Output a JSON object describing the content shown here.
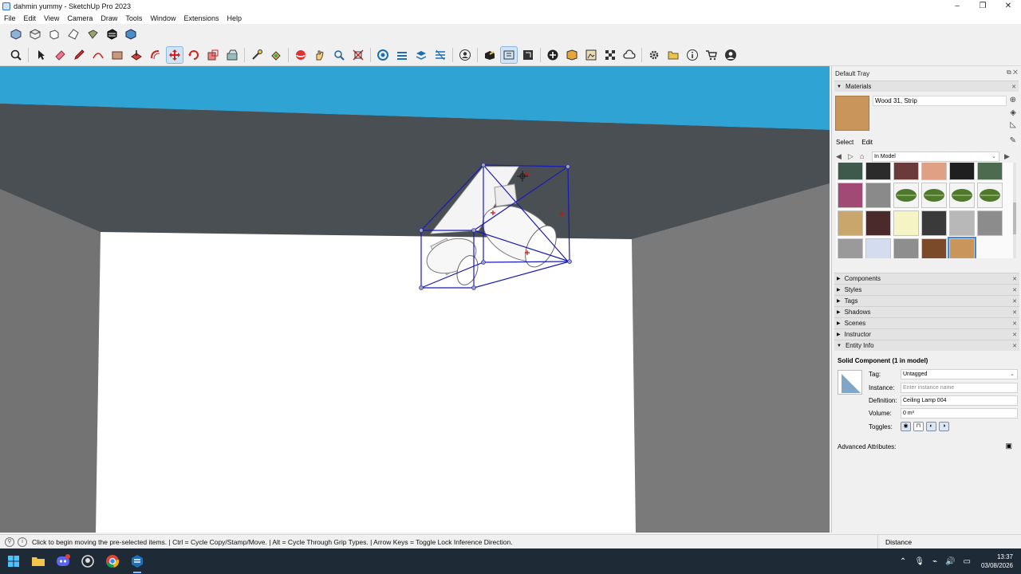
{
  "window": {
    "title": "dahmin yummy - SketchUp Pro 2023",
    "minimize": "–",
    "maximize": "❐",
    "close": "✕"
  },
  "menu": [
    "File",
    "Edit",
    "View",
    "Camera",
    "Draw",
    "Tools",
    "Window",
    "Extensions",
    "Help"
  ],
  "toolbar_top": [
    "iso-view-icon",
    "top-view-icon",
    "front-view-icon",
    "right-view-icon",
    "back-view-icon",
    "left-view-icon",
    "bottom-view-icon"
  ],
  "toolbar_main": [
    "zoom-icon",
    "select-icon",
    "eraser-icon",
    "pencil-icon",
    "arc-icon",
    "rectangle-icon",
    "pushpull-icon",
    "offset-icon",
    "move-icon",
    "rotate-icon",
    "scale-icon",
    "followme-icon",
    "tape-icon",
    "paint-icon",
    "orbit-icon",
    "pan-icon",
    "zoom-window-icon",
    "zoom-extents-icon",
    "section-plane-icon",
    "display-section-icon",
    "section-fill-icon",
    "section-cuts-icon",
    "user-icon",
    "3d-warehouse-icon",
    "extension-warehouse-icon",
    "layout-icon",
    "add-location-icon",
    "geo-icon",
    "photo-texture-icon",
    "scan-icon",
    "cloud-icon",
    "settings-icon",
    "folder-icon",
    "info-icon",
    "cart-icon",
    "account-icon"
  ],
  "tray": {
    "title": "Default Tray",
    "materials": {
      "header": "Materials",
      "current_name": "Wood 31, Strip",
      "current_color": "#c9955a",
      "tab_select": "Select",
      "tab_edit": "Edit",
      "library": "In Model",
      "swatches": [
        "#3e5a4c",
        "#2b2b2b",
        "#6b3a3a",
        "#e0a084",
        "#1f1f1f",
        "#4d6b4f",
        "#a04a75",
        "#8a8a8a",
        "leaf",
        "leaf",
        "leaf",
        "leaf",
        "#c9a66b",
        "#4a2a2a",
        "#f4f4c4",
        "#3a3a3a",
        "#b8b8b8",
        "#8c8c8c",
        "#9a9a9a",
        "#d4dcef",
        "#8e8e8e",
        "#7a4a2a",
        "#c9955a"
      ]
    },
    "sections": [
      "Components",
      "Styles",
      "Tags",
      "Shadows",
      "Scenes",
      "Instructor",
      "Entity Info"
    ],
    "entity": {
      "title": "Solid Component (1 in model)",
      "tag_label": "Tag:",
      "tag_value": "Untagged",
      "instance_label": "Instance:",
      "instance_placeholder": "Enter instance name",
      "definition_label": "Definition:",
      "definition_value": "Ceiling Lamp 004",
      "volume_label": "Volume:",
      "volume_value": "0 m³",
      "toggles_label": "Toggles:",
      "advanced": "Advanced Attributes:"
    }
  },
  "status": {
    "message": "Click to begin moving the pre-selected items. | Ctrl = Cycle Copy/Stamp/Move. | Alt = Cycle Through Grip Types. | Arrow Keys = Toggle Lock Inference Direction.",
    "measure_label": "Distance"
  },
  "taskbar": {
    "time": "13:37",
    "date": "03/08/2026",
    "apps": [
      "windows-start-icon",
      "file-explorer-icon",
      "discord-icon",
      "github-icon",
      "chrome-icon",
      "sketchup-icon"
    ]
  }
}
